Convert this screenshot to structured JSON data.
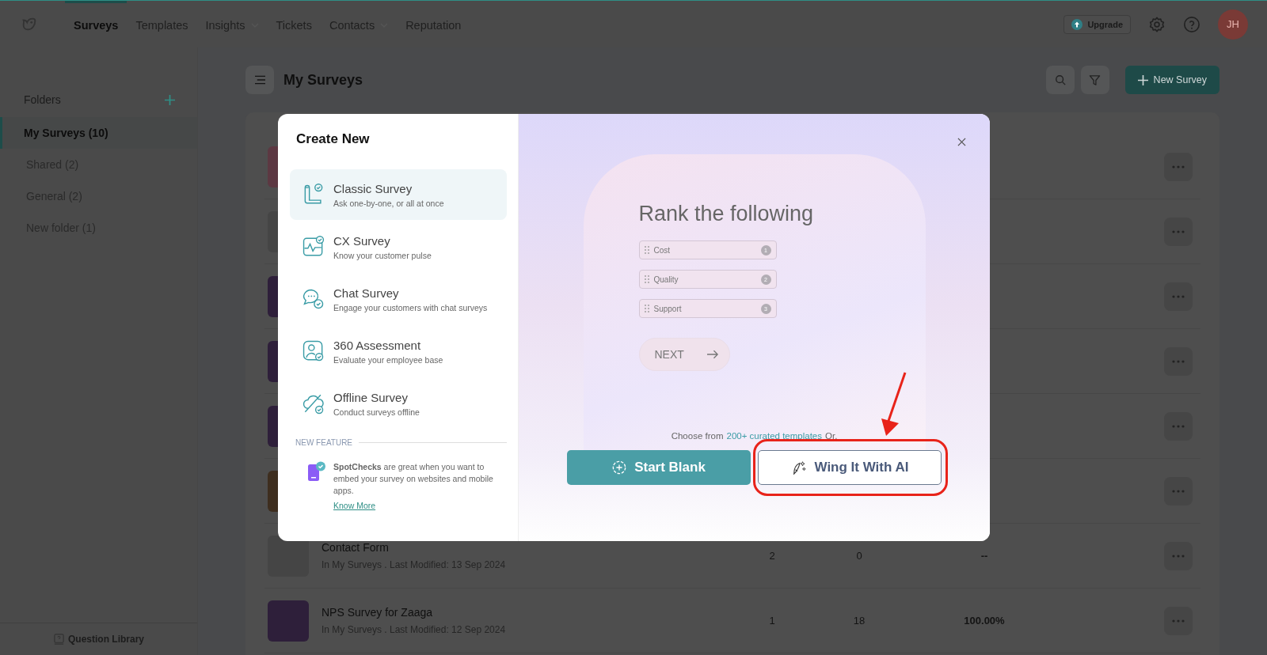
{
  "nav": {
    "items": [
      {
        "label": "Surveys",
        "selected": true,
        "dropdown": false
      },
      {
        "label": "Templates",
        "selected": false,
        "dropdown": false
      },
      {
        "label": "Insights",
        "selected": false,
        "dropdown": true
      },
      {
        "label": "Tickets",
        "selected": false,
        "dropdown": false
      },
      {
        "label": "Contacts",
        "selected": false,
        "dropdown": true
      },
      {
        "label": "Reputation",
        "selected": false,
        "dropdown": false
      }
    ],
    "upgrade": "Upgrade",
    "avatar": "JH"
  },
  "sidebar": {
    "title": "Folders",
    "items": [
      {
        "label": "My Surveys (10)",
        "selected": true
      },
      {
        "label": "Shared (2)",
        "selected": false
      },
      {
        "label": "General (2)",
        "selected": false
      },
      {
        "label": "New folder (1)",
        "selected": false
      }
    ],
    "footer": "Question Library"
  },
  "main": {
    "title": "My Surveys",
    "new_button": "New Survey",
    "rows": [
      {
        "color": "#5c3842"
      },
      {
        "color": "#454545"
      },
      {
        "color": "#2e1f3a"
      },
      {
        "color": "#2e1f3a"
      },
      {
        "color": "#2e1f3a"
      },
      {
        "color": "#3e2e1f"
      },
      {
        "color": "#454545",
        "title": "Contact Form",
        "subtitle": "In My Surveys . Last Modified: 13 Sep 2024",
        "col_1": "2",
        "col_2": "0",
        "col_3": "--"
      },
      {
        "color": "#2e1f3a",
        "title": "NPS Survey for Zaaga",
        "subtitle": "In My Surveys . Last Modified: 12 Sep 2024",
        "col_1": "1",
        "col_2": "18",
        "col_3": "100.00%"
      }
    ]
  },
  "modal": {
    "title": "Create New",
    "types": [
      {
        "title": "Classic Survey",
        "description": "Ask one-by-one, or all at once",
        "selected": true
      },
      {
        "title": "CX Survey",
        "description": "Know your customer pulse",
        "selected": false
      },
      {
        "title": "Chat Survey",
        "description": "Engage your customers with chat surveys",
        "selected": false
      },
      {
        "title": "360 Assessment",
        "description": "Evaluate your employee base",
        "selected": false
      },
      {
        "title": "Offline Survey",
        "description": "Conduct surveys offline",
        "selected": false
      }
    ],
    "new_feature": "NEW FEATURE",
    "feature_text": "**SpotChecks** are great when you want to embed your survey on websites and mobile apps.",
    "feature_link": "Know More",
    "preview": {
      "title": "Rank the following",
      "options": [
        {
          "label": "Cost",
          "rank": "1"
        },
        {
          "label": "Quality",
          "rank": "2"
        },
        {
          "label": "Support",
          "rank": "3"
        }
      ],
      "next": "NEXT"
    },
    "choose_prefix": "Choose from",
    "choose_link": "200+ curated templates",
    "choose_suffix": "Or,",
    "start_blank": "Start Blank",
    "wing_ai": {
      "label": "Wing It With AI",
      "highlighted": true
    }
  }
}
